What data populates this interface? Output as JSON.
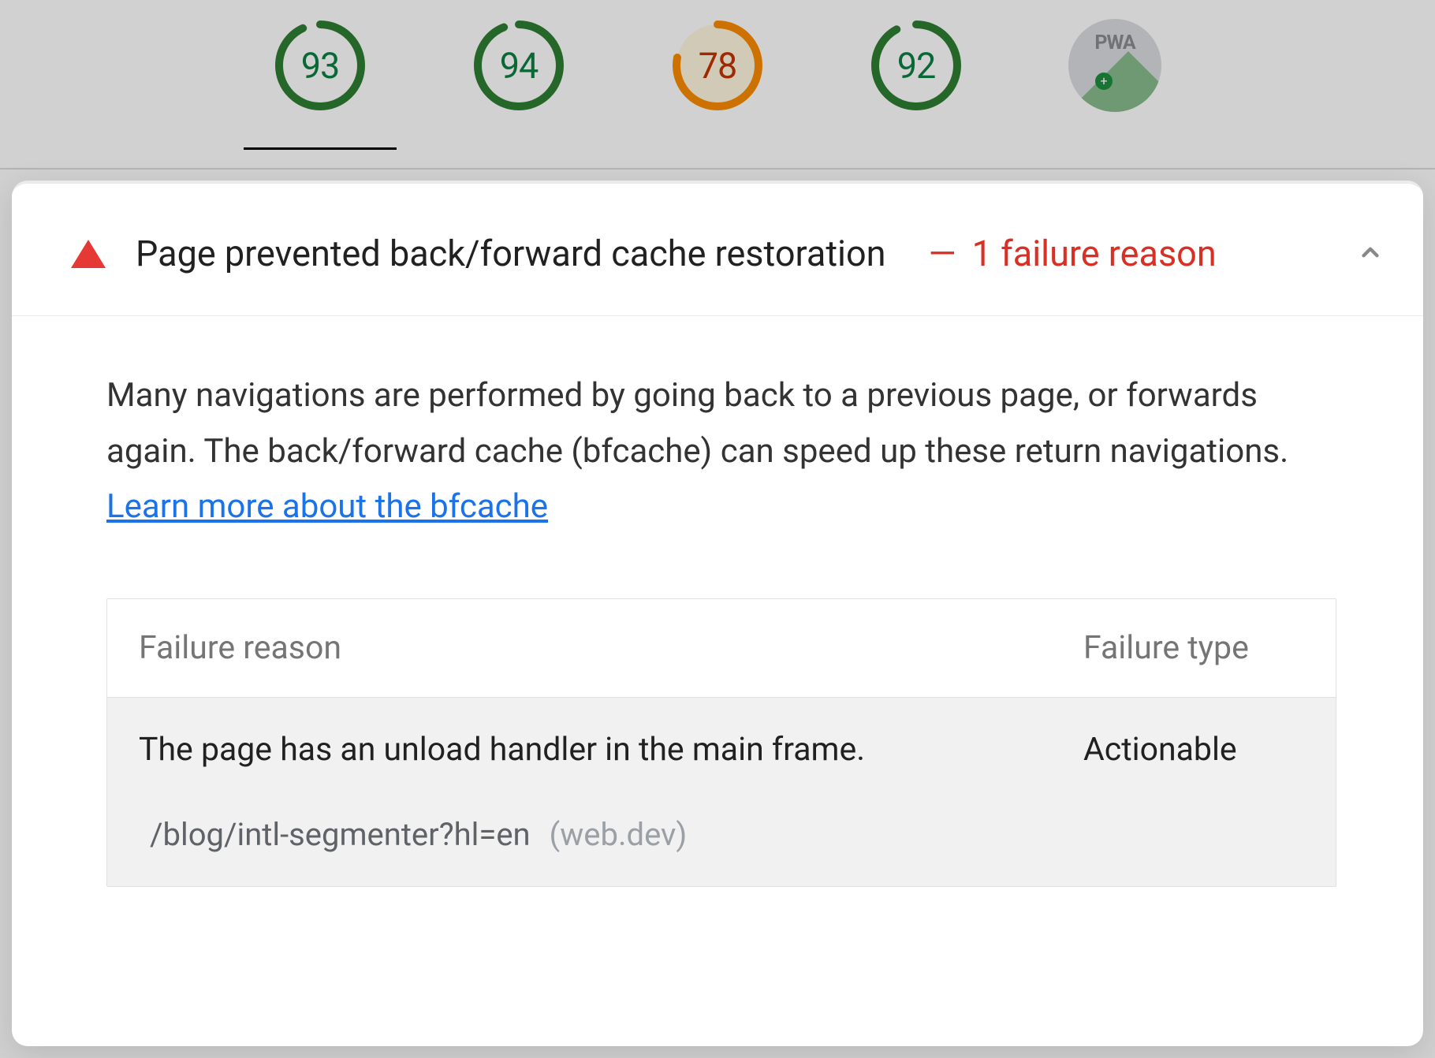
{
  "scores": {
    "items": [
      {
        "value": "93",
        "status": "green",
        "arc": 0.93,
        "active": true
      },
      {
        "value": "94",
        "status": "green",
        "arc": 0.94,
        "active": false
      },
      {
        "value": "78",
        "status": "orange",
        "arc": 0.78,
        "active": false
      },
      {
        "value": "92",
        "status": "green",
        "arc": 0.92,
        "active": false
      }
    ],
    "pwa_label": "PWA"
  },
  "audit": {
    "title": "Page prevented back/forward cache restoration",
    "fail_dash": "—",
    "fail_count_text": "1 failure reason",
    "description_pre": "Many navigations are performed by going back to a previous page, or forwards again. The back/forward cache (bfcache) can speed up these return navigations. ",
    "link_text": "Learn more about the bfcache",
    "table": {
      "col_reason": "Failure reason",
      "col_type": "Failure type",
      "row": {
        "reason": "The page has an unload handler in the main frame.",
        "type": "Actionable",
        "sub_path": "/blog/intl-segmenter?hl=en",
        "sub_domain": "(web.dev)"
      }
    }
  },
  "colors": {
    "green_stroke": "#2e7d32",
    "green_bg": "#e6f4ea",
    "orange_stroke": "#fb8c00",
    "orange_bg": "#fef7e0",
    "fail_red": "#d93025"
  }
}
